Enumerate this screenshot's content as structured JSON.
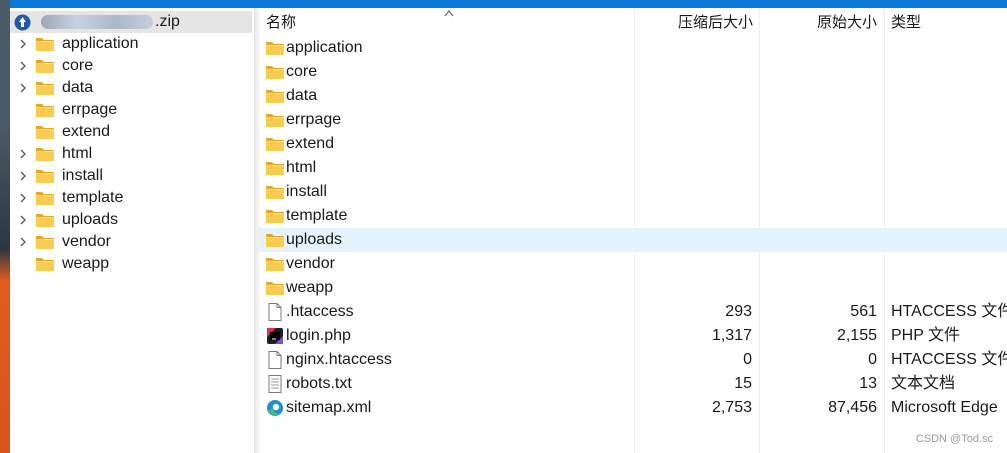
{
  "tree": {
    "root_label": ".zip",
    "items": [
      {
        "label": "application",
        "expandable": true
      },
      {
        "label": "core",
        "expandable": true
      },
      {
        "label": "data",
        "expandable": true
      },
      {
        "label": "errpage",
        "expandable": false
      },
      {
        "label": "extend",
        "expandable": false
      },
      {
        "label": "html",
        "expandable": true
      },
      {
        "label": "install",
        "expandable": true
      },
      {
        "label": "template",
        "expandable": true
      },
      {
        "label": "uploads",
        "expandable": true
      },
      {
        "label": "vendor",
        "expandable": true
      },
      {
        "label": "weapp",
        "expandable": false
      }
    ]
  },
  "columns": {
    "name": "名称",
    "compressed": "压缩后大小",
    "original": "原始大小",
    "type": "类型"
  },
  "files": [
    {
      "name": "application",
      "icon": "folder-icon",
      "compressed": "",
      "original": "",
      "type": ""
    },
    {
      "name": "core",
      "icon": "folder-icon",
      "compressed": "",
      "original": "",
      "type": ""
    },
    {
      "name": "data",
      "icon": "folder-icon",
      "compressed": "",
      "original": "",
      "type": ""
    },
    {
      "name": "errpage",
      "icon": "folder-icon",
      "compressed": "",
      "original": "",
      "type": ""
    },
    {
      "name": "extend",
      "icon": "folder-icon",
      "compressed": "",
      "original": "",
      "type": ""
    },
    {
      "name": "html",
      "icon": "folder-icon",
      "compressed": "",
      "original": "",
      "type": ""
    },
    {
      "name": "install",
      "icon": "folder-icon",
      "compressed": "",
      "original": "",
      "type": ""
    },
    {
      "name": "template",
      "icon": "folder-icon",
      "compressed": "",
      "original": "",
      "type": ""
    },
    {
      "name": "uploads",
      "icon": "folder-icon",
      "compressed": "",
      "original": "",
      "type": "",
      "selected": true
    },
    {
      "name": "vendor",
      "icon": "folder-icon",
      "compressed": "",
      "original": "",
      "type": ""
    },
    {
      "name": "weapp",
      "icon": "folder-icon",
      "compressed": "",
      "original": "",
      "type": ""
    },
    {
      "name": ".htaccess",
      "icon": "blank-file-icon",
      "compressed": "293",
      "original": "561",
      "type": "HTACCESS 文件"
    },
    {
      "name": "login.php",
      "icon": "php-file-icon",
      "compressed": "1,317",
      "original": "2,155",
      "type": "PHP 文件"
    },
    {
      "name": "nginx.htaccess",
      "icon": "blank-file-icon",
      "compressed": "0",
      "original": "0",
      "type": "HTACCESS 文件"
    },
    {
      "name": "robots.txt",
      "icon": "text-file-icon",
      "compressed": "15",
      "original": "13",
      "type": "文本文档"
    },
    {
      "name": "sitemap.xml",
      "icon": "edge-file-icon",
      "compressed": "2,753",
      "original": "87,456",
      "type": "Microsoft Edge"
    }
  ],
  "watermark": "CSDN @Tod.sc",
  "colors": {
    "accent": "#0a78d7",
    "folder": "#f7c948",
    "selection": "#e5f3ff"
  }
}
